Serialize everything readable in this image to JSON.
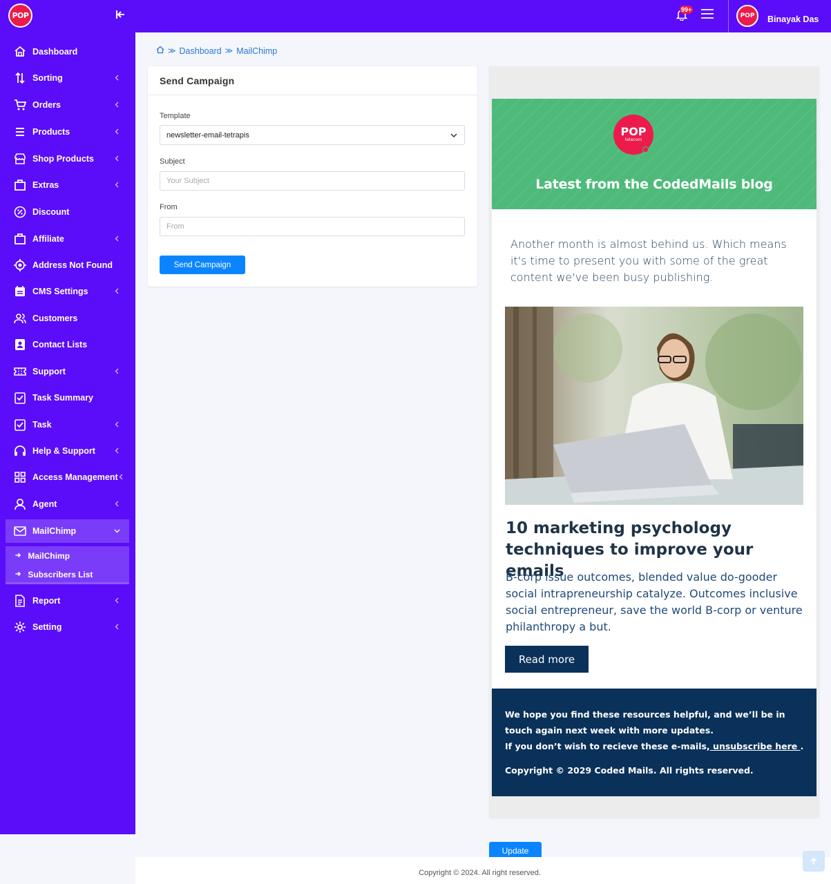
{
  "brand": {
    "logo_text": "POP",
    "logo_sub": "telecom"
  },
  "sidebar": {
    "items": [
      {
        "label": "Dashboard",
        "icon": "home-icon",
        "has_children": false
      },
      {
        "label": "Sorting",
        "icon": "sort-icon",
        "has_children": true
      },
      {
        "label": "Orders",
        "icon": "cart-icon",
        "has_children": true
      },
      {
        "label": "Products",
        "icon": "list-icon",
        "has_children": true
      },
      {
        "label": "Shop Products",
        "icon": "shop-icon",
        "has_children": true
      },
      {
        "label": "Extras",
        "icon": "box-icon",
        "has_children": true
      },
      {
        "label": "Discount",
        "icon": "percent-icon",
        "has_children": false
      },
      {
        "label": "Affiliate",
        "icon": "box-icon",
        "has_children": true
      },
      {
        "label": "Address Not Found",
        "icon": "crosshair-icon",
        "has_children": false
      },
      {
        "label": "CMS Settings",
        "icon": "calendar-icon",
        "has_children": true
      },
      {
        "label": "Customers",
        "icon": "users-icon",
        "has_children": false
      },
      {
        "label": "Contact Lists",
        "icon": "contact-book-icon",
        "has_children": false
      },
      {
        "label": "Support",
        "icon": "ticket-icon",
        "has_children": true
      },
      {
        "label": "Task Summary",
        "icon": "checklist-icon",
        "has_children": false
      },
      {
        "label": "Task",
        "icon": "checklist-icon",
        "has_children": true
      },
      {
        "label": "Help & Support",
        "icon": "headset-icon",
        "has_children": true
      },
      {
        "label": "Access Management",
        "icon": "grid-icon",
        "has_children": true
      },
      {
        "label": "Agent",
        "icon": "user-icon",
        "has_children": true
      },
      {
        "label": "MailChimp",
        "icon": "mail-icon",
        "has_children": true,
        "active": true
      },
      {
        "label": "Report",
        "icon": "document-icon",
        "has_children": true
      },
      {
        "label": "Setting",
        "icon": "gear-icon",
        "has_children": true
      }
    ],
    "submenu": [
      {
        "label": "MailChimp"
      },
      {
        "label": "Subscribers List"
      }
    ]
  },
  "topbar": {
    "notification_badge": "99+",
    "user_name": "Binayak Das"
  },
  "breadcrumb": {
    "items": [
      "Dashboard",
      "MailChimp"
    ]
  },
  "form": {
    "title": "Send Campaign",
    "template_label": "Template",
    "template_value": "newsletter-email-tetrapis",
    "subject_label": "Subject",
    "subject_placeholder": "Your Subject",
    "from_label": "From",
    "from_placeholder": "From",
    "submit_label": "Send Campaign"
  },
  "preview": {
    "hero_title": "Latest from the CodedMails blog",
    "intro": "Another month is almost behind us. Which means it's time to present you with some of the great content we've been busy publishing.",
    "article_title": "10 marketing psychology techniques to improve your emails",
    "article_body": "B-corp issue outcomes, blended value do-gooder social intrapreneurship catalyze. Outcomes inclusive social entrepreneur, save the world B-corp or venture philanthropy a but.",
    "read_more": "Read more",
    "footer_line1": "We hope you find these resources helpful, and we’ll be in touch again next week with more updates.",
    "footer_line2_prefix": "If you don’t wish to recieve these e-mails,",
    "footer_unsubscribe": " unsubscribe here ",
    "footer_line2_suffix": ".",
    "footer_copyright": "Copyright © 2029 Coded Mails. All rights reserved."
  },
  "update_label": "Update",
  "footer": {
    "copyright": "Copyright © 2024. All right reserved."
  },
  "colors": {
    "sidebar": "#5b0cf8",
    "accent": "#0a85ff",
    "brand_red": "#ec1b4b",
    "hero_green": "#4dba7a",
    "navy": "#0a3159"
  }
}
